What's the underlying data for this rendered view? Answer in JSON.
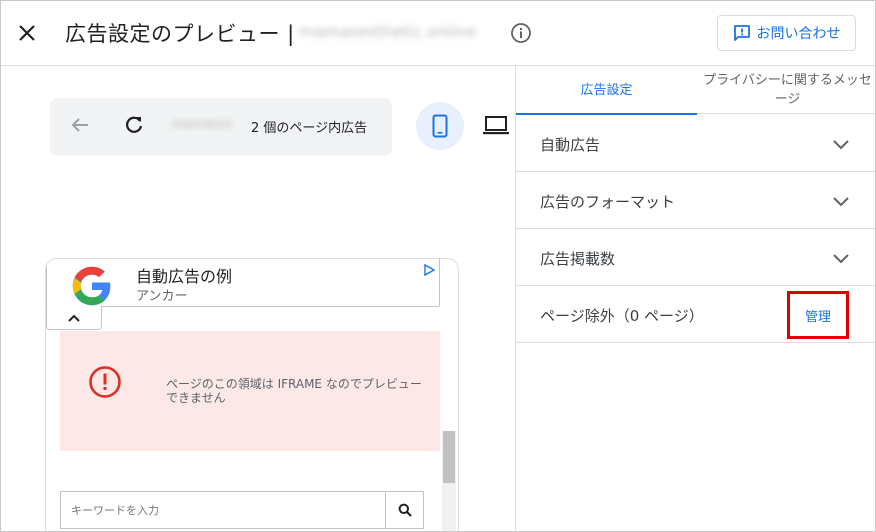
{
  "header": {
    "title": "広告設定のプレビュー |",
    "domain_blurred": "mamasesthetic.online",
    "contact_label": "お問い合わせ"
  },
  "preview": {
    "site_blurred": "mamasss",
    "ad_count_label": "2 個のページ内広告",
    "anchor_ad": {
      "title": "自動広告の例",
      "subtitle": "アンカー"
    },
    "iframe_message": "ページのこの領域は IFRAME なのでプレビューできません",
    "keyword_placeholder": "キーワードを入力"
  },
  "settings": {
    "tabs": [
      {
        "label": "広告設定",
        "active": true
      },
      {
        "label": "プライバシーに関するメッセージ",
        "active": false
      }
    ],
    "sections": [
      {
        "label": "自動広告"
      },
      {
        "label": "広告のフォーマット"
      },
      {
        "label": "広告掲載数"
      }
    ],
    "page_exclusion_label": "ページ除外（0 ページ）",
    "manage_label": "管理"
  },
  "colors": {
    "accent": "#1a73e8",
    "highlight_border": "#e00000",
    "iframe_bg": "#fce8e6",
    "warning": "#d93025"
  }
}
